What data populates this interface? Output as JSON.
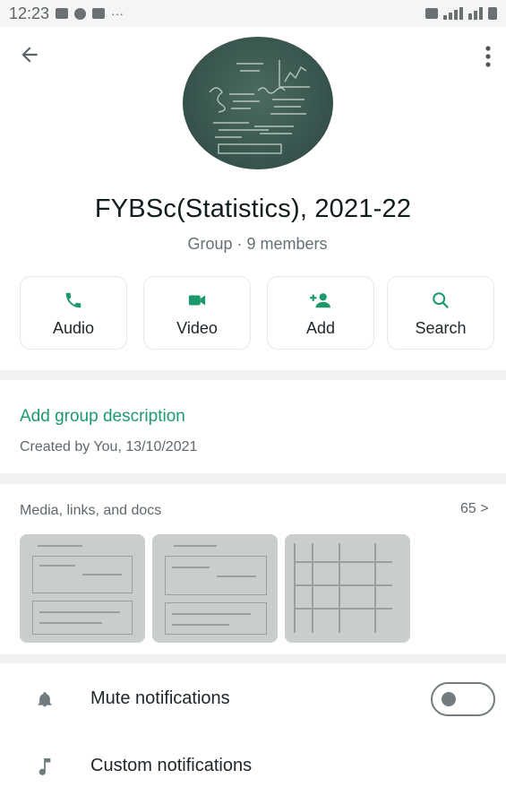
{
  "status_bar": {
    "time": "12:23",
    "dots": "···"
  },
  "header": {
    "group_name": "FYBSc(Statistics), 2021-22",
    "subtitle": "Group · 9 members"
  },
  "actions": [
    {
      "label": "Audio",
      "icon": "phone-icon"
    },
    {
      "label": "Video",
      "icon": "video-camera-icon"
    },
    {
      "label": "Add",
      "icon": "add-person-icon"
    },
    {
      "label": "Search",
      "icon": "search-icon"
    }
  ],
  "description": {
    "add_label": "Add group description",
    "created_text": "Created by You, 13/10/2021"
  },
  "media": {
    "title": "Media, links, and docs",
    "count": "65 >"
  },
  "settings": {
    "mute_label": "Mute notifications",
    "custom_label": "Custom notifications",
    "mute_enabled": false
  },
  "colors": {
    "accent": "#1c9a6b",
    "header_bg": "#ffffff",
    "page_bg": "#f0f2f1"
  }
}
